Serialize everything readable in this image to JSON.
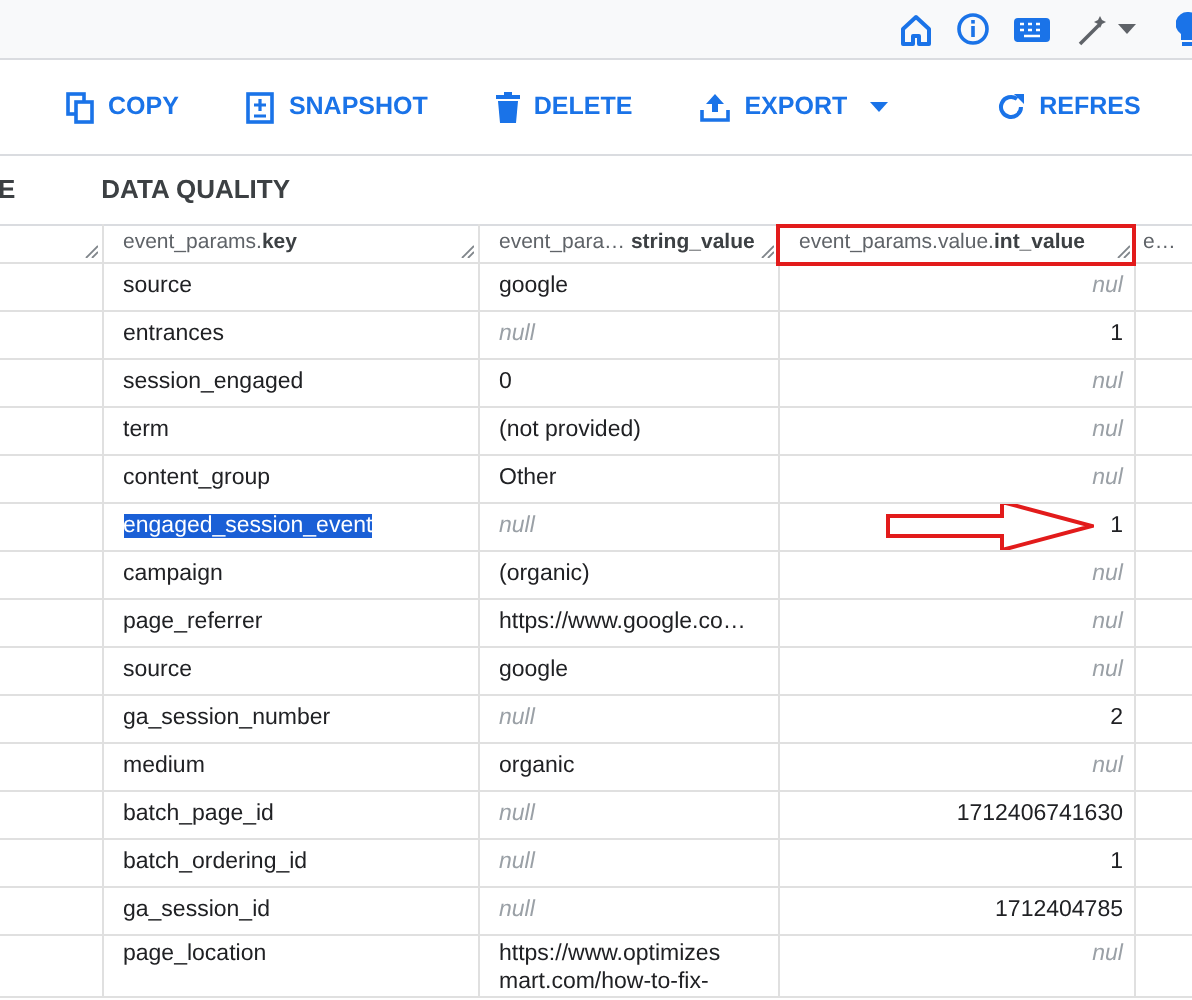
{
  "top_bar": {
    "icons": [
      {
        "kind": "home"
      },
      {
        "kind": "info"
      },
      {
        "kind": "keyboard"
      },
      {
        "kind": "wand"
      },
      {
        "kind": "bulb"
      }
    ]
  },
  "toolbar": {
    "buttons": [
      {
        "kind": "copy",
        "label": "COPY"
      },
      {
        "kind": "snapshot",
        "label": "SNAPSHOT"
      },
      {
        "kind": "delete",
        "label": "DELETE"
      },
      {
        "kind": "export",
        "label": "EXPORT"
      },
      {
        "kind": "refresh",
        "label": "REFRES"
      }
    ]
  },
  "tabs": [
    {
      "label": "E",
      "selected": false
    },
    {
      "label": "DATA QUALITY",
      "selected": false
    }
  ],
  "table": {
    "columns": [
      {
        "highlighted": false,
        "kind": "text"
      },
      {
        "header": "event_params.**key**",
        "highlighted": false,
        "kind": "text"
      },
      {
        "header": "event_para… **string_value**",
        "highlighted": false,
        "kind": "text"
      },
      {
        "header": "event_params.value.**int_value**",
        "highlighted": true,
        "kind": "number"
      },
      {
        "header": "e…",
        "highlighted": false,
        "kind": "text"
      }
    ],
    "rows": [
      {
        "key": "source",
        "selected": false,
        "arrow": false,
        "string_value": {
          "text": "google",
          "kind": "value"
        },
        "int_value": {
          "text": "nul",
          "kind": "null"
        }
      },
      {
        "key": "entrances",
        "selected": false,
        "arrow": false,
        "string_value": {
          "text": "null",
          "kind": "null"
        },
        "int_value": {
          "text": "1",
          "kind": "value"
        }
      },
      {
        "key": "session_engaged",
        "selected": false,
        "arrow": false,
        "string_value": {
          "text": "0",
          "kind": "value"
        },
        "int_value": {
          "text": "nul",
          "kind": "null"
        }
      },
      {
        "key": "term",
        "selected": false,
        "arrow": false,
        "string_value": {
          "text": "(not provided)",
          "kind": "value"
        },
        "int_value": {
          "text": "nul",
          "kind": "null"
        }
      },
      {
        "key": "content_group",
        "selected": false,
        "arrow": false,
        "string_value": {
          "text": "Other",
          "kind": "value"
        },
        "int_value": {
          "text": "nul",
          "kind": "null"
        }
      },
      {
        "key": "engaged_session_event",
        "selected": true,
        "arrow": true,
        "string_value": {
          "text": "null",
          "kind": "null"
        },
        "int_value": {
          "text": "1",
          "kind": "value"
        }
      },
      {
        "key": "campaign",
        "selected": false,
        "arrow": false,
        "string_value": {
          "text": "(organic)",
          "kind": "value"
        },
        "int_value": {
          "text": "nul",
          "kind": "null"
        }
      },
      {
        "key": "page_referrer",
        "selected": false,
        "arrow": false,
        "string_value": {
          "text": "https://www.google.co…",
          "kind": "value"
        },
        "int_value": {
          "text": "nul",
          "kind": "null"
        }
      },
      {
        "key": "source",
        "selected": false,
        "arrow": false,
        "string_value": {
          "text": "google",
          "kind": "value"
        },
        "int_value": {
          "text": "nul",
          "kind": "null"
        }
      },
      {
        "key": "ga_session_number",
        "selected": false,
        "arrow": false,
        "string_value": {
          "text": "null",
          "kind": "null"
        },
        "int_value": {
          "text": "2",
          "kind": "value"
        }
      },
      {
        "key": "medium",
        "selected": false,
        "arrow": false,
        "string_value": {
          "text": "organic",
          "kind": "value"
        },
        "int_value": {
          "text": "nul",
          "kind": "null"
        }
      },
      {
        "key": "batch_page_id",
        "selected": false,
        "arrow": false,
        "string_value": {
          "text": "null",
          "kind": "null"
        },
        "int_value": {
          "text": "1712406741630",
          "kind": "value"
        }
      },
      {
        "key": "batch_ordering_id",
        "selected": false,
        "arrow": false,
        "string_value": {
          "text": "null",
          "kind": "null"
        },
        "int_value": {
          "text": "1",
          "kind": "value"
        }
      },
      {
        "key": "ga_session_id",
        "selected": false,
        "arrow": false,
        "string_value": {
          "text": "null",
          "kind": "null"
        },
        "int_value": {
          "text": "1712404785",
          "kind": "value"
        }
      },
      {
        "key": "page_location",
        "selected": false,
        "arrow": false,
        "string_value": {
          "text": "https://www.optimizesmart.com/how-to-fix-",
          "kind": "value"
        },
        "int_value": {
          "text": "nul",
          "kind": "null"
        }
      }
    ]
  }
}
